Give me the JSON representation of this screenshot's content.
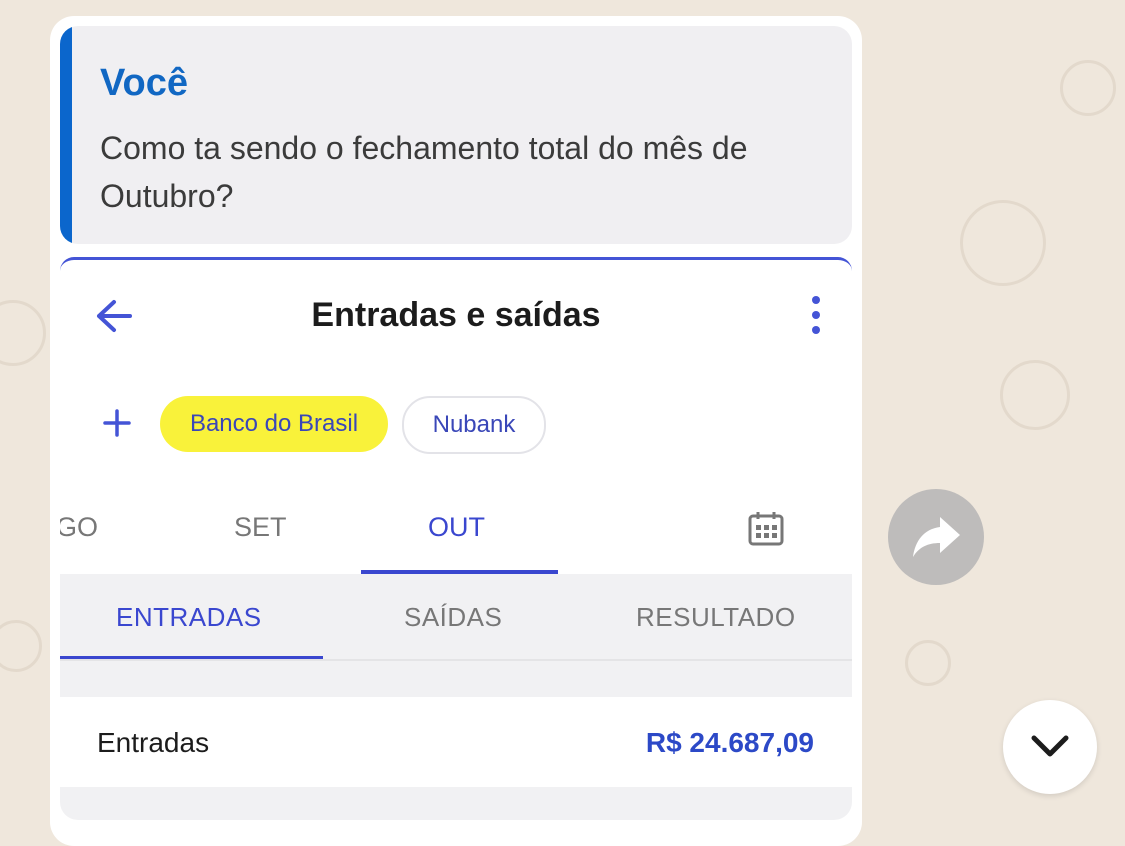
{
  "quote": {
    "author": "Você",
    "text": "Como ta sendo o fechamento total do mês de Outubro?"
  },
  "app": {
    "title": "Entradas e saídas",
    "accounts": [
      "Banco do Brasil",
      "Nubank"
    ],
    "months": [
      "GO",
      "SET",
      "OUT"
    ],
    "tabs": [
      "ENTRADAS",
      "SAÍDAS",
      "RESULTADO"
    ],
    "row": {
      "label": "Entradas",
      "value": "R$ 24.687,09"
    }
  },
  "icons": {
    "back": "arrow-left-icon",
    "more": "kebab-menu-icon",
    "add": "plus-icon",
    "calendar": "calendar-icon",
    "forward": "forward-icon",
    "scroll": "chevron-down-icon"
  },
  "colors": {
    "accent": "#3a47cf",
    "quote_bar": "#0b66cc",
    "chip_selected": "#f9f23a",
    "wallpaper": "#efe7dc"
  }
}
